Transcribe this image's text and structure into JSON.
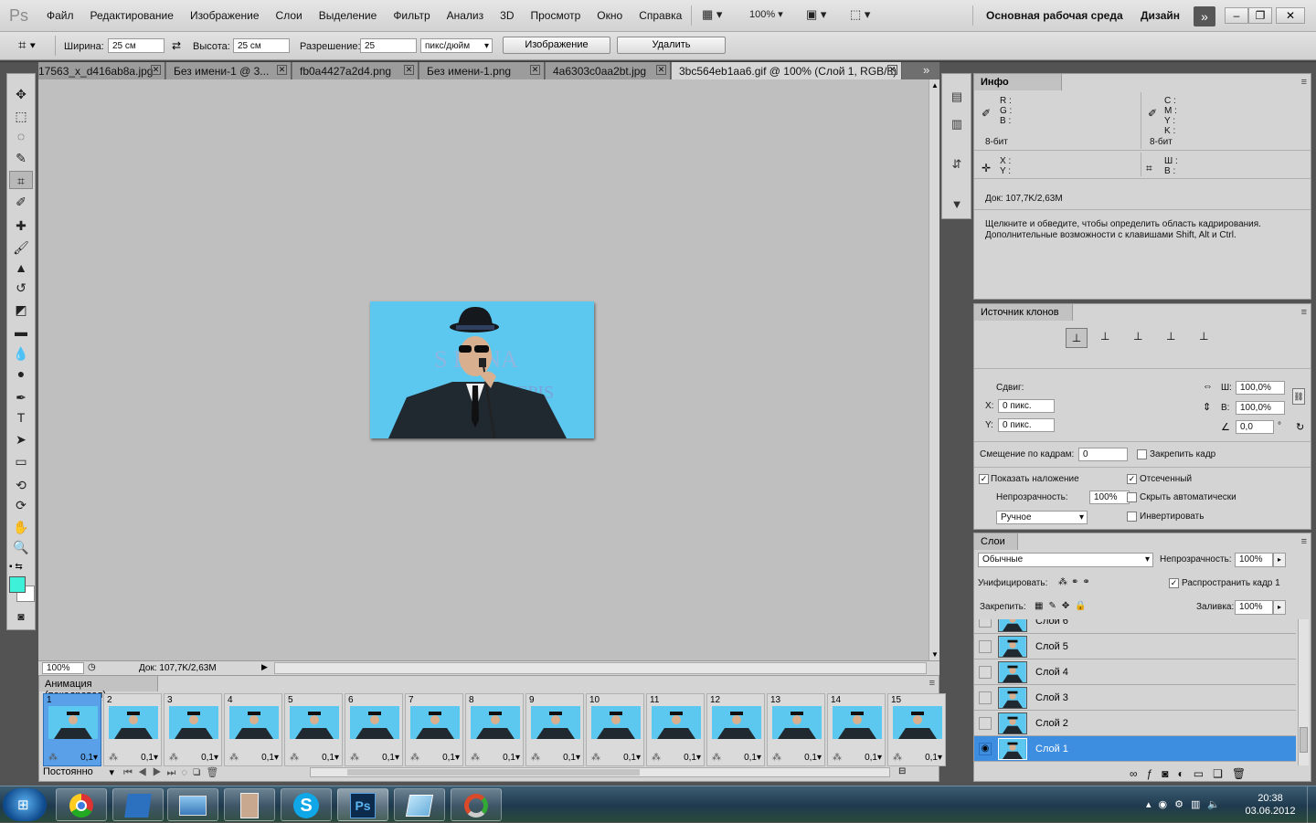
{
  "app": {
    "logo": "Ps"
  },
  "menu": [
    "Файл",
    "Редактирование",
    "Изображение",
    "Слои",
    "Выделение",
    "Фильтр",
    "Анализ",
    "3D",
    "Просмотр",
    "Окно",
    "Справка"
  ],
  "menubar": {
    "zoom": "100%",
    "workspace": "Основная рабочая среда",
    "design": "Дизайн"
  },
  "options": {
    "width_label": "Ширина:",
    "width_value": "25 см",
    "height_label": "Высота:",
    "height_value": "25 см",
    "resolution_label": "Разрешение:",
    "resolution_value": "25",
    "unit": "пикс/дюйм",
    "image_button": "Изображение",
    "delete_button": "Удалить"
  },
  "tabs": [
    {
      "label": "17563_x_d416ab8a.jpg"
    },
    {
      "label": "Без имени-1 @ 3..."
    },
    {
      "label": "fb0a4427a2d4.png"
    },
    {
      "label": "Без имени-1.png"
    },
    {
      "label": "4a6303c0aa2bt.jpg"
    },
    {
      "label": "3bc564eb1aa6.gif @ 100% (Слой 1, RGB/8)"
    }
  ],
  "status": {
    "zoom": "100%",
    "doc": "Док: 107,7K/2,63M"
  },
  "animation": {
    "title": "Анимация (покадровая)",
    "loop": "Постоянно",
    "frames": [
      {
        "n": "1",
        "delay": "0,1"
      },
      {
        "n": "2",
        "delay": "0,1"
      },
      {
        "n": "3",
        "delay": "0,1"
      },
      {
        "n": "4",
        "delay": "0,1"
      },
      {
        "n": "5",
        "delay": "0,1"
      },
      {
        "n": "6",
        "delay": "0,1"
      },
      {
        "n": "7",
        "delay": "0,1"
      },
      {
        "n": "8",
        "delay": "0,1"
      },
      {
        "n": "9",
        "delay": "0,1"
      },
      {
        "n": "10",
        "delay": "0,1"
      },
      {
        "n": "11",
        "delay": "0,1"
      },
      {
        "n": "12",
        "delay": "0,1"
      },
      {
        "n": "13",
        "delay": "0,1"
      },
      {
        "n": "14",
        "delay": "0,1"
      },
      {
        "n": "15",
        "delay": "0,1"
      }
    ]
  },
  "info": {
    "title": "Инфо",
    "rgb": [
      "R :",
      "G :",
      "B :"
    ],
    "cmyk": [
      "C :",
      "M :",
      "Y :",
      "K :"
    ],
    "bits_left": "8-бит",
    "bits_right": "8-бит",
    "xy": [
      "X :",
      "Y :"
    ],
    "wh": [
      "Ш :",
      "В :"
    ],
    "doc": "Док: 107,7K/2,63M",
    "hint1": "Щелкните и обведите, чтобы определить область кадрирования.",
    "hint2": "Дополнительные возможности с клавишами Shift, Alt и Ctrl."
  },
  "clone": {
    "title": "Источник клонов",
    "offset_label": "Сдвиг:",
    "x_label": "X:",
    "x_value": "0 пикс.",
    "y_label": "Y:",
    "y_value": "0 пикс.",
    "w_label": "Ш:",
    "w_value": "100,0%",
    "h_label": "В:",
    "h_value": "100,0%",
    "angle_value": "0,0",
    "angle_unit": "°",
    "frame_offset_label": "Смещение по кадрам:",
    "frame_offset_value": "0",
    "lock_frame": "Закрепить кадр",
    "show_overlay": "Показать наложение",
    "clipped": "Отсеченный",
    "opacity_label": "Непрозрачность:",
    "opacity_value": "100%",
    "auto_hide": "Скрыть автоматически",
    "mode": "Ручное",
    "invert": "Инвертировать"
  },
  "layers": {
    "title": "Слои",
    "blend": "Обычные",
    "opacity_label": "Непрозрачность:",
    "opacity_value": "100%",
    "unify_label": "Унифицировать:",
    "propagate": "Распространить кадр 1",
    "lock_label": "Закрепить:",
    "fill_label": "Заливка:",
    "fill_value": "100%",
    "items": [
      {
        "name": "Слой 6"
      },
      {
        "name": "Слой 5"
      },
      {
        "name": "Слой 4"
      },
      {
        "name": "Слой 3"
      },
      {
        "name": "Слой 2"
      },
      {
        "name": "Слой 1"
      }
    ]
  },
  "taskbar": {
    "time": "20:38",
    "date": "03.06.2012"
  }
}
